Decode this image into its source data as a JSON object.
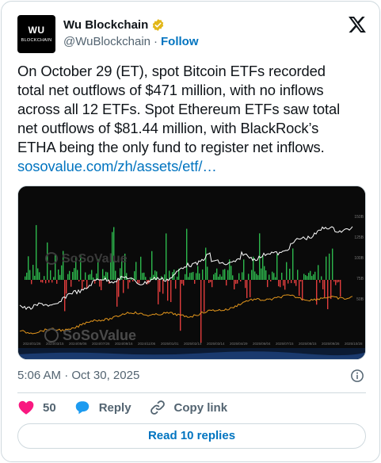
{
  "author": {
    "avatar_line1": "WU",
    "avatar_line2": "BLOCKCHAIN",
    "display_name": "Wu Blockchain",
    "handle": "@WuBlockchain",
    "separator": "·",
    "follow_label": "Follow",
    "verified_badge_color": "#e2b719"
  },
  "tweet": {
    "line1": "On October 29 (ET), spot Bitcoin ETFs recorded",
    "line2": "total net outflows of $471 million, with no inflows",
    "line3": "across all 12 ETFs. Spot Ethereum ETFs saw total",
    "line4": "net outflows of $81.44 million, with BlackRock’s",
    "line5": "ETHA being the only fund to register net inflows.",
    "link_text": "sosovalue.com/zh/assets/etf/…"
  },
  "media": {
    "watermark_top": "SoSoValue",
    "watermark_bottom": "SoSoValue",
    "y_ticks": [
      "150B",
      "125B",
      "100B",
      "75B",
      "50B"
    ],
    "x_ticks": [
      "2024/01/26",
      "2024/03/15",
      "2024/05/06",
      "2024/07/26",
      "2024/09/16",
      "2024/11/06",
      "2025/01/01",
      "2025/02/14",
      "2025/03/14",
      "2025/04/29",
      "2025/06/04",
      "2025/07/15",
      "2025/08/15",
      "2025/09/26",
      "2025/10/28"
    ],
    "colors": {
      "inflow": "#2db84d",
      "outflow": "#e23d3d",
      "total_line": "#ffffff",
      "price_line": "#e3961c"
    }
  },
  "meta": {
    "time": "5:06 AM",
    "separator": "·",
    "date": "Oct 30, 2025"
  },
  "actions": {
    "like_count": "50",
    "reply_label": "Reply",
    "copy_label": "Copy link",
    "accent_heart": "#f91880",
    "accent_reply": "#1d9bf0"
  },
  "replies_button": "Read 10 replies"
}
